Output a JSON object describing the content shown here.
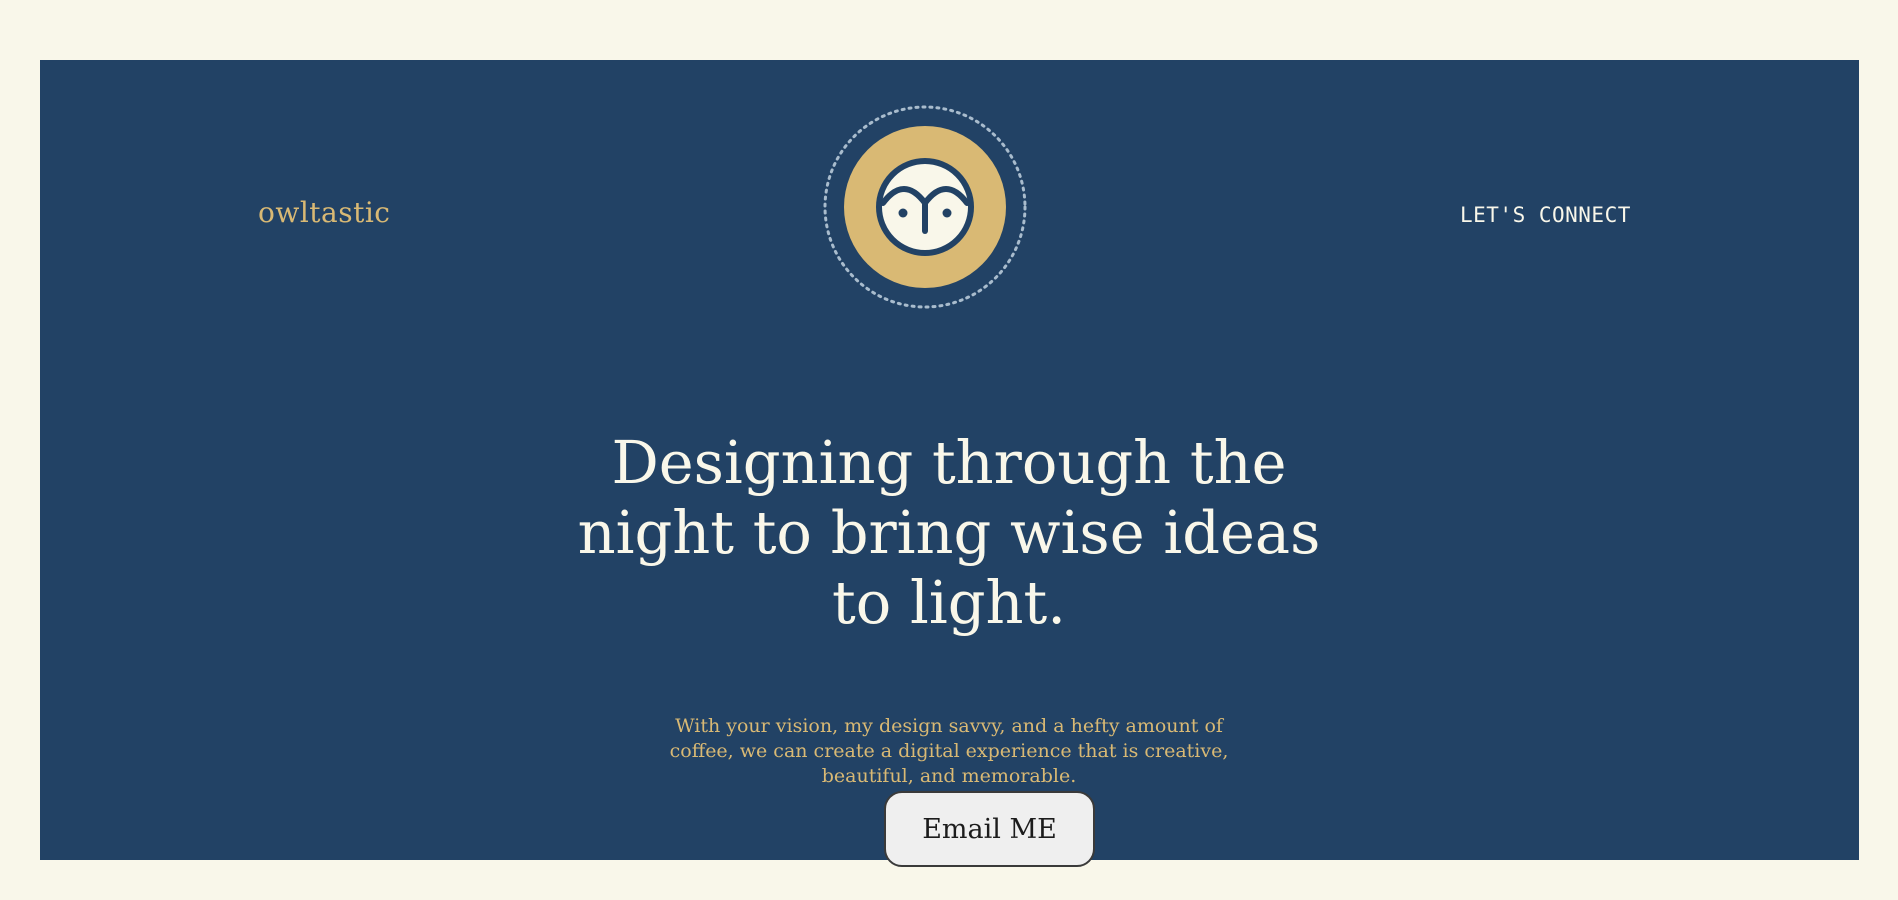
{
  "brand": {
    "name": "owltastic"
  },
  "logo": {
    "icon": "owl-face-icon"
  },
  "nav": {
    "connect_label": "LET'S CONNECT"
  },
  "hero": {
    "headline": "Designing through the night to bring wise ideas to light.",
    "subtext": "With your vision, my design savvy, and a hefty amount of coffee, we can create a digital experience that is creative, beautiful, and memorable.",
    "cta_label": "Email ME"
  },
  "colors": {
    "page_background": "#f9f7ea",
    "hero_background": "#224265",
    "accent_gold": "#d9b974",
    "cream": "#f9f7ea"
  }
}
